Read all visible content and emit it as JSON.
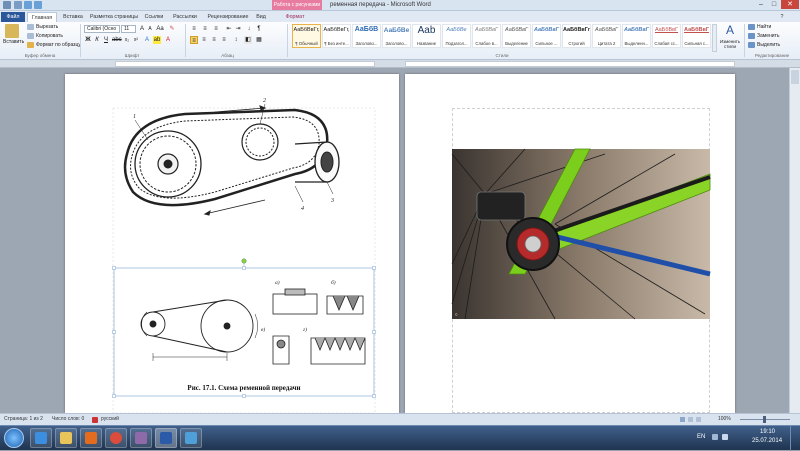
{
  "title_bar": {
    "context_tab": "Работа с рисунками",
    "document_title": "ременная передача - Microsoft Word"
  },
  "tabs": [
    {
      "label": "Файл"
    },
    {
      "label": "Главная"
    },
    {
      "label": "Вставка"
    },
    {
      "label": "Разметка страницы"
    },
    {
      "label": "Ссылки"
    },
    {
      "label": "Рассылки"
    },
    {
      "label": "Рецензирование"
    },
    {
      "label": "Вид"
    },
    {
      "label": "Формат"
    }
  ],
  "clipboard": {
    "paste": "Вставить",
    "cut": "Вырезать",
    "copy": "Копировать",
    "format_painter": "Формат по образцу",
    "group": "Буфер обмена"
  },
  "font": {
    "name": "Calibri (Осно",
    "size": "11",
    "group": "Шрифт"
  },
  "paragraph": {
    "group": "Абзац"
  },
  "styles": {
    "group": "Стили",
    "items": [
      {
        "preview": "АаБбВвГг,",
        "name": "¶ Обычный",
        "color": "#222222"
      },
      {
        "preview": "АаБбВвГг,",
        "name": "¶ Без инте...",
        "color": "#222222"
      },
      {
        "preview": "АаБбВ",
        "name": "Заголово...",
        "color": "#2e6ab3"
      },
      {
        "preview": "АаБбВе",
        "name": "Заголово...",
        "color": "#4f81bd"
      },
      {
        "preview": "Aab",
        "name": "Название",
        "color": "#17365d"
      },
      {
        "preview": "АаБбВе",
        "name": "Подзагол...",
        "color": "#4f81bd"
      },
      {
        "preview": "АаБбВвГ",
        "name": "Слабое в...",
        "color": "#808080"
      },
      {
        "preview": "АаБбВвГ",
        "name": "Выделение",
        "color": "#555555"
      },
      {
        "preview": "АаБбВвГ",
        "name": "Сильное ...",
        "color": "#555555"
      },
      {
        "preview": "АаБбВвГг",
        "name": "Строгий",
        "color": "#222222"
      },
      {
        "preview": "АаБбВвГ",
        "name": "Цитата 2",
        "color": "#555555"
      },
      {
        "preview": "АаБбВвГ",
        "name": "Выделенн...",
        "color": "#4f81bd"
      },
      {
        "preview": "АаБбВвГ",
        "name": "Слабая сс...",
        "color": "#c0504d"
      },
      {
        "preview": "АаБбВвГ",
        "name": "Сильная с...",
        "color": "#c0504d"
      }
    ]
  },
  "change_styles": "Изменить стили",
  "editing": {
    "find": "Найти",
    "replace": "Заменить",
    "select": "Выделить",
    "group": "Редактирование"
  },
  "figure": {
    "caption": "Рис. 17.1. Схема ременной передачи",
    "labels": [
      "1",
      "2",
      "3",
      "4"
    ],
    "sub_labels": [
      "а)",
      "б)",
      "в)",
      "г)"
    ]
  },
  "status_bar": {
    "page": "Страница: 1 из 2",
    "words": "Число слов: 0",
    "language": "русский",
    "zoom": "100%"
  },
  "taskbar": {
    "lang": "EN",
    "time": "19:10",
    "date": "25.07.2014"
  }
}
